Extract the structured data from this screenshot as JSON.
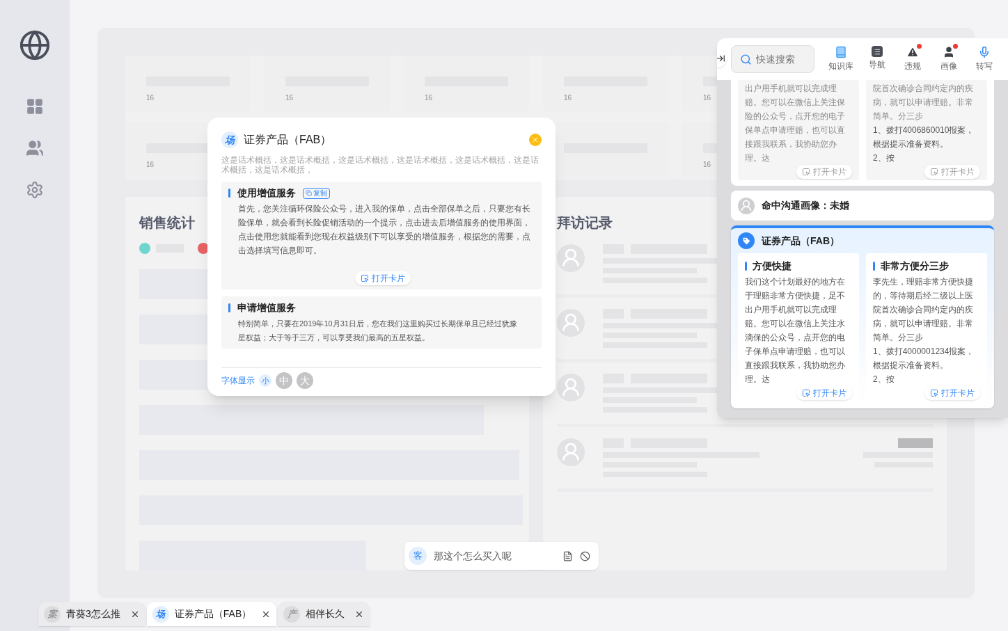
{
  "stat_rows": [
    [
      "16",
      "16",
      "16",
      "16",
      "16"
    ],
    [
      "16",
      "16"
    ]
  ],
  "sections": {
    "sales_title": "销售统计",
    "visits_title": "拜访记录"
  },
  "card_modal": {
    "icon_char": "场",
    "title": "证券产品（FAB）",
    "summary": "这是话术概括，这是话术概括，这是话术概括，这是话术概括，这是话术概括，这是话术概括，这是话术概括，",
    "sections": [
      {
        "title": "使用增值服务",
        "copy_label": "复制",
        "lines": [
          "首先，您关注循环保险公众号，进入我的保单，点击全部保单之后，只要您有长险保单，就会看到长险促销活动的一个提示，点击进去后增值服务的使用界面，点击使用您就能看到您现在权益级别下可以享受的增值服务，根据您的需要，点击选择填写信息即可。"
        ],
        "open_label": "打开卡片"
      },
      {
        "title": "申请增值服务",
        "lines": [
          "特别简单，只要在2019年10月31日后，您在我们这里购买过长期保单且已经过犹豫",
          "星权益；大于等于三万，可以享受我们最高的五星权益。"
        ]
      }
    ],
    "font_label": "字体显示",
    "font_sizes": [
      {
        "label": "小",
        "selected": true
      },
      {
        "label": "中",
        "selected": false
      },
      {
        "label": "大",
        "selected": false
      }
    ]
  },
  "assistant": {
    "search_placeholder": "快速搜索",
    "tools": [
      {
        "kind": "book",
        "label": "知识库",
        "alert": false
      },
      {
        "kind": "nav",
        "label": "导航",
        "alert": false
      },
      {
        "kind": "warning",
        "label": "违规",
        "alert": true
      },
      {
        "kind": "person",
        "label": "画像",
        "alert": true
      },
      {
        "kind": "mic",
        "label": "转写",
        "alert": false
      }
    ],
    "scrolled_card": {
      "columns": [
        {
          "paragraphs": [
            "出户用手机就可以完成理赔。您可以在微信上关注保险的公众号，点开您的电子保单点申请理赔，也可以直接跟我联系，我协助您办理。达"
          ],
          "open_label": "打开卡片"
        },
        {
          "paragraphs": [
            "院首次确诊合同约定内的疾病，就可以申请理赔。非常简单。分三步",
            "1、拨打4006860010报案，根据提示准备资料。",
            "2、按"
          ],
          "open_label": "打开卡片"
        }
      ]
    },
    "portrait": "命中沟通画像：未婚",
    "product_card": {
      "title": "证券产品（FAB）",
      "columns": [
        {
          "title": "方便快捷",
          "paragraphs": [
            "我们这个计划最好的地方在于理赔非常方便快捷，足不出户用手机就可以完成理赔。您可以在微信上关注水滴保的公众号，点开您的电子保单点申请理赔，也可以直接跟我联系，我协助您办理。达"
          ],
          "open_label": "打开卡片"
        },
        {
          "title": "非常方便分三步",
          "paragraphs": [
            "李先生，理赔非常方便快捷的，等待期后经二级以上医院首次确诊合同约定内的疾病，就可以申请理赔。非常简单。分三步",
            "1、拨打4000001234报案，根据提示准备资料。",
            "2、按"
          ],
          "open_label": "打开卡片"
        }
      ]
    }
  },
  "chat": {
    "avatar_char": "客",
    "text": "那这个怎么买入呢"
  },
  "tabs": [
    {
      "icon_char": "案",
      "label": "青葵3怎么推",
      "selected": false
    },
    {
      "icon_char": "场",
      "label": "证券产品（FAB）",
      "selected": true
    },
    {
      "icon_char": "产",
      "label": "相伴长久",
      "selected": false
    }
  ]
}
